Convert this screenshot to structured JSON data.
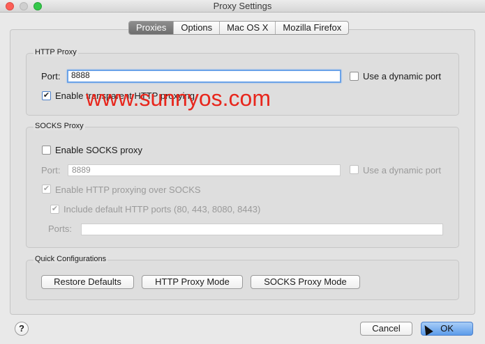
{
  "window": {
    "title": "Proxy Settings"
  },
  "tabs": [
    {
      "label": "Proxies",
      "active": true
    },
    {
      "label": "Options",
      "active": false
    },
    {
      "label": "Mac OS X",
      "active": false
    },
    {
      "label": "Mozilla Firefox",
      "active": false
    }
  ],
  "http_proxy": {
    "group_title": "HTTP Proxy",
    "port_label": "Port:",
    "port_value": "8888",
    "dynamic_port_label": "Use a dynamic port",
    "dynamic_port_checked": false,
    "transparent_label": "Enable transparent HTTP proxying",
    "transparent_checked": true
  },
  "socks_proxy": {
    "group_title": "SOCKS Proxy",
    "enable_label": "Enable SOCKS proxy",
    "enable_checked": false,
    "port_label": "Port:",
    "port_value": "8889",
    "dynamic_port_label": "Use a dynamic port",
    "http_over_socks_label": "Enable HTTP proxying over SOCKS",
    "http_over_socks_checked": true,
    "include_default_label": "Include default HTTP ports (80, 443, 8080, 8443)",
    "include_default_checked": true,
    "ports_label": "Ports:",
    "ports_value": ""
  },
  "quick_config": {
    "group_title": "Quick Configurations",
    "restore_label": "Restore Defaults",
    "http_mode_label": "HTTP Proxy Mode",
    "socks_mode_label": "SOCKS Proxy Mode"
  },
  "footer": {
    "help_label": "?",
    "cancel_label": "Cancel",
    "ok_label": "OK"
  },
  "watermark": "www.sunnyos.com",
  "check_glyph": "✔",
  "colors": {
    "accent": "#6aa2e8",
    "default_button": "#5c9cea",
    "watermark": "#e8261c"
  }
}
